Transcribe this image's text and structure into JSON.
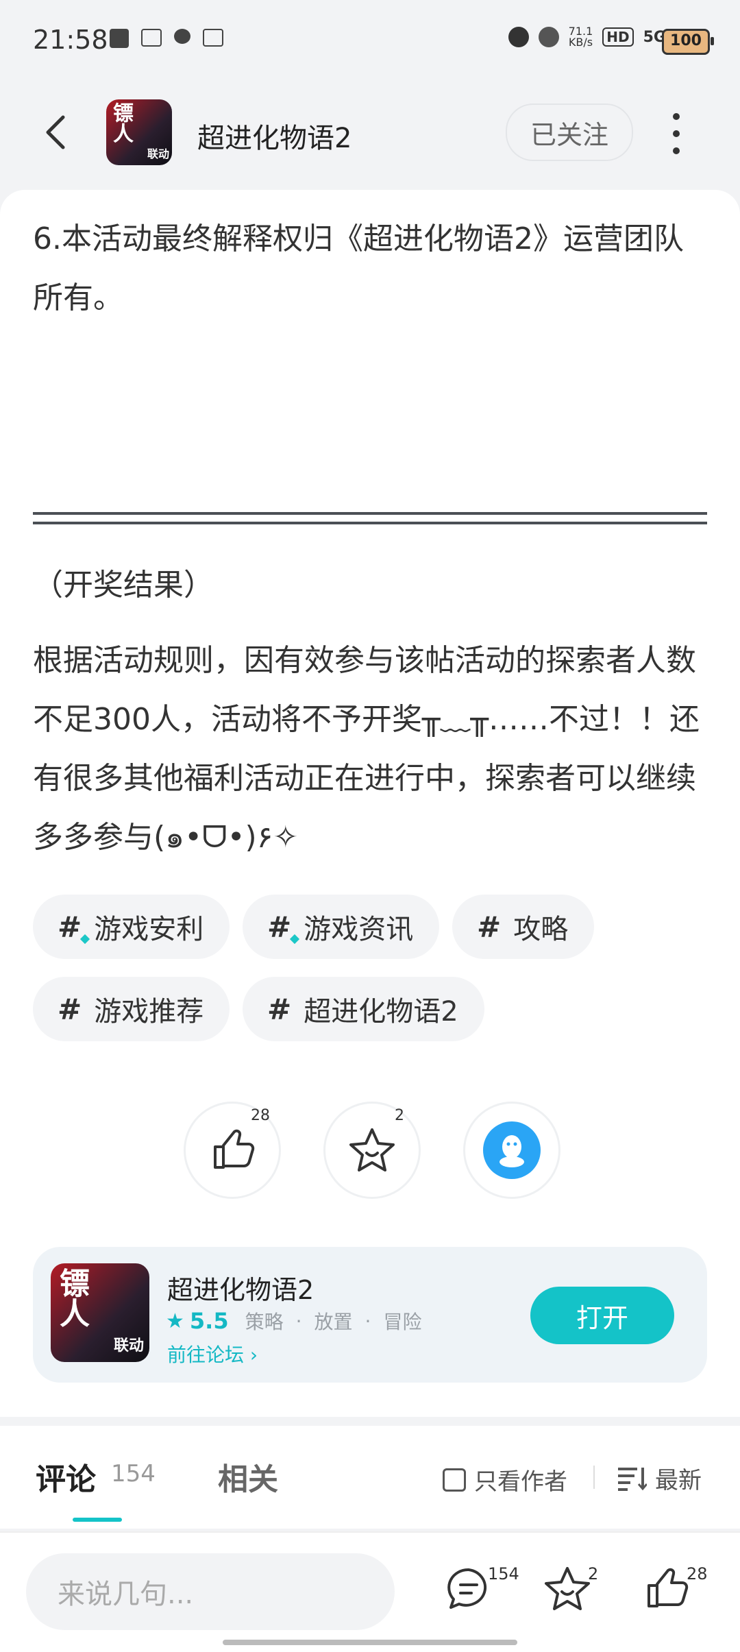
{
  "status_bar": {
    "time": "21:58",
    "net_speed": "71.1",
    "net_unit": "KB/s",
    "hd": "HD",
    "network": "5G",
    "battery": "100"
  },
  "header": {
    "title": "超进化物语2",
    "follow_label": "已关注",
    "icon_text": "镖人",
    "icon_tag": "联动"
  },
  "article": {
    "rule_6": "6.本活动最终解释权归《超进化物语2》运营团队所有。",
    "results_title": "（开奖结果）",
    "results_body": "根据活动规则，因有效参与该帖活动的探索者人数不足300人，活动将不予开奖╥﹏╥……不过！！还有很多其他福利活动正在进行中，探索者可以继续多多参与(๑•ᗜ•)۶✧"
  },
  "tags": [
    "游戏安利",
    "游戏资讯",
    "攻略",
    "游戏推荐",
    "超进化物语2"
  ],
  "actions": {
    "like_count": "28",
    "favorite_count": "2"
  },
  "game_card": {
    "name": "超进化物语2",
    "score": "5.5",
    "genres": [
      "策略",
      "放置",
      "冒险"
    ],
    "forum_link": "前往论坛",
    "open_label": "打开",
    "icon_text": "镖人",
    "icon_tag": "联动"
  },
  "comments_tabs": {
    "comments_label": "评论",
    "comments_count": "154",
    "related_label": "相关",
    "author_only_label": "只看作者",
    "sort_label": "最新"
  },
  "bottom_bar": {
    "input_placeholder": "来说几句...",
    "comment_count": "154",
    "favorite_count": "2",
    "like_count": "28"
  },
  "colors": {
    "accent": "#14c3c8",
    "qq_blue": "#2aa5f5"
  }
}
